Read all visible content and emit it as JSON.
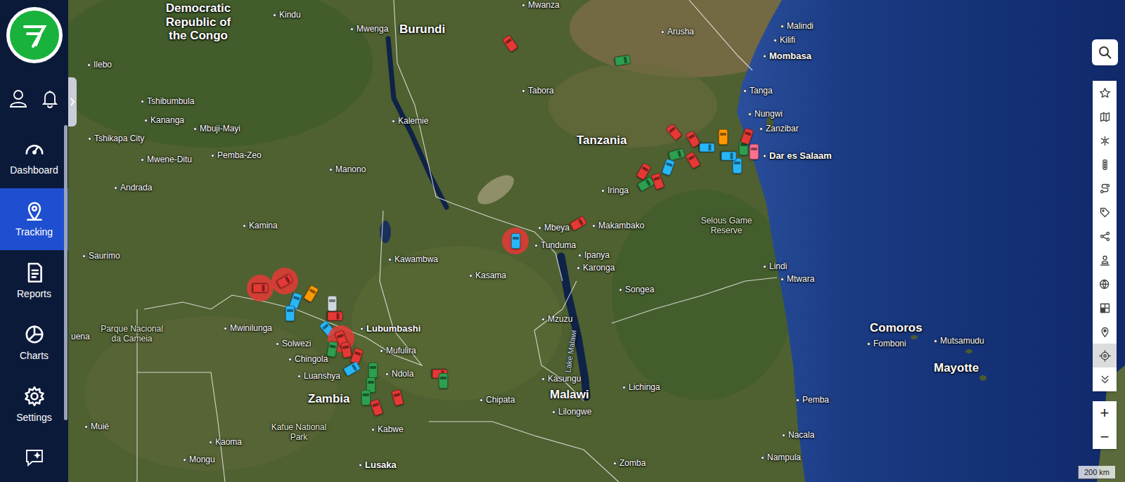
{
  "sidebar": {
    "items": [
      {
        "label": "Dashboard",
        "selected": false
      },
      {
        "label": "Tracking",
        "selected": true
      },
      {
        "label": "Reports",
        "selected": false
      },
      {
        "label": "Charts",
        "selected": false
      },
      {
        "label": "Settings",
        "selected": false
      }
    ]
  },
  "map": {
    "labels": [
      {
        "text": "Democratic Republic of the Congo",
        "kind": "country"
      },
      {
        "text": "Kindu",
        "kind": "city"
      },
      {
        "text": "Mwanza",
        "kind": "city"
      },
      {
        "text": "Burundi",
        "kind": "country"
      },
      {
        "text": "Mwenga",
        "kind": "city"
      },
      {
        "text": "Arusha",
        "kind": "city"
      },
      {
        "text": "Malindi",
        "kind": "city"
      },
      {
        "text": "Kilifi",
        "kind": "city"
      },
      {
        "text": "Mombasa",
        "kind": "major"
      },
      {
        "text": "Ilebo",
        "kind": "city"
      },
      {
        "text": "Tabora",
        "kind": "city"
      },
      {
        "text": "Tanga",
        "kind": "city"
      },
      {
        "text": "Tshibumbula",
        "kind": "city"
      },
      {
        "text": "Nungwi",
        "kind": "city"
      },
      {
        "text": "Kananga",
        "kind": "city"
      },
      {
        "text": "Mbuji-Mayi",
        "kind": "city"
      },
      {
        "text": "Kalemie",
        "kind": "city"
      },
      {
        "text": "Zanzibar",
        "kind": "city"
      },
      {
        "text": "Tshikapa City",
        "kind": "city"
      },
      {
        "text": "Tanzania",
        "kind": "country"
      },
      {
        "text": "Dar es Salaam",
        "kind": "major"
      },
      {
        "text": "Mwene-Ditu",
        "kind": "city"
      },
      {
        "text": "Pemba-Zeo",
        "kind": "city"
      },
      {
        "text": "Manono",
        "kind": "city"
      },
      {
        "text": "Andrada",
        "kind": "city"
      },
      {
        "text": "Iringa",
        "kind": "city"
      },
      {
        "text": "Selous Game Reserve",
        "kind": "area"
      },
      {
        "text": "Kamina",
        "kind": "city"
      },
      {
        "text": "Mbeya",
        "kind": "city"
      },
      {
        "text": "Makambako",
        "kind": "city"
      },
      {
        "text": "Tunduma",
        "kind": "city"
      },
      {
        "text": "Ipanya",
        "kind": "city"
      },
      {
        "text": "Karonga",
        "kind": "city"
      },
      {
        "text": "Saurimo",
        "kind": "city"
      },
      {
        "text": "Kawambwa",
        "kind": "city"
      },
      {
        "text": "Lindi",
        "kind": "city"
      },
      {
        "text": "Mtwara",
        "kind": "city"
      },
      {
        "text": "Kasama",
        "kind": "city"
      },
      {
        "text": "Songea",
        "kind": "city"
      },
      {
        "text": "Mzuzu",
        "kind": "city"
      },
      {
        "text": "Lubumbashi",
        "kind": "major"
      },
      {
        "text": "Mwinilunga",
        "kind": "city"
      },
      {
        "text": "Parque Nacional da Cameia",
        "kind": "area"
      },
      {
        "text": "uena",
        "kind": "town"
      },
      {
        "text": "Comoros",
        "kind": "country"
      },
      {
        "text": "Fomboni",
        "kind": "city"
      },
      {
        "text": "Mutsamudu",
        "kind": "city"
      },
      {
        "text": "Mayotte",
        "kind": "country"
      },
      {
        "text": "Solwezi",
        "kind": "city"
      },
      {
        "text": "Chingola",
        "kind": "city"
      },
      {
        "text": "Mufulira",
        "kind": "city"
      },
      {
        "text": "Luanshya",
        "kind": "city"
      },
      {
        "text": "Ndola",
        "kind": "city"
      },
      {
        "text": "Zambia",
        "kind": "country"
      },
      {
        "text": "Kasungu",
        "kind": "city"
      },
      {
        "text": "Lichinga",
        "kind": "city"
      },
      {
        "text": "Chipata",
        "kind": "city"
      },
      {
        "text": "Malawi",
        "kind": "country"
      },
      {
        "text": "Lilongwe",
        "kind": "city"
      },
      {
        "text": "Pemba",
        "kind": "city"
      },
      {
        "text": "Kafue National Park",
        "kind": "area"
      },
      {
        "text": "Kabwe",
        "kind": "city"
      },
      {
        "text": "Muié",
        "kind": "city"
      },
      {
        "text": "Kaoma",
        "kind": "city"
      },
      {
        "text": "Nacala",
        "kind": "city"
      },
      {
        "text": "Nampula",
        "kind": "city"
      },
      {
        "text": "Mongu",
        "kind": "city"
      },
      {
        "text": "Lusaka",
        "kind": "major"
      },
      {
        "text": "Zomba",
        "kind": "city"
      },
      {
        "text": "Lake Malawi",
        "kind": "water"
      }
    ],
    "vehicles": [
      {
        "color": "#e53935",
        "highlighted": false
      },
      {
        "color": "#2e9e4f",
        "highlighted": false
      },
      {
        "color": "#e53935",
        "highlighted": false
      },
      {
        "color": "#e53935",
        "highlighted": false
      },
      {
        "color": "#2e9e4f",
        "highlighted": false
      },
      {
        "color": "#29b6f6",
        "highlighted": false
      },
      {
        "color": "#e53935",
        "highlighted": false
      },
      {
        "color": "#ff9800",
        "highlighted": false
      },
      {
        "color": "#2e9e4f",
        "highlighted": false
      },
      {
        "color": "#29b6f6",
        "highlighted": false
      },
      {
        "color": "#ff6f91",
        "highlighted": false
      },
      {
        "color": "#29b6f6",
        "highlighted": false
      },
      {
        "color": "#e53935",
        "highlighted": false
      },
      {
        "color": "#e53935",
        "highlighted": false
      },
      {
        "color": "#e53935",
        "highlighted": false
      },
      {
        "color": "#29b6f6",
        "highlighted": false
      },
      {
        "color": "#2e9e4f",
        "highlighted": false
      },
      {
        "color": "#e53935",
        "highlighted": false
      },
      {
        "color": "#29b6f6",
        "highlighted": true
      },
      {
        "color": "#e53935",
        "highlighted": true
      },
      {
        "color": "#e53935",
        "highlighted": true
      },
      {
        "color": "#29b6f6",
        "highlighted": false
      },
      {
        "color": "#ff9800",
        "highlighted": false
      },
      {
        "color": "#29b6f6",
        "highlighted": false
      },
      {
        "color": "#cfd8dc",
        "highlighted": false
      },
      {
        "color": "#e53935",
        "highlighted": false
      },
      {
        "color": "#29b6f6",
        "highlighted": false
      },
      {
        "color": "#e53935",
        "highlighted": true
      },
      {
        "color": "#2e9e4f",
        "highlighted": false
      },
      {
        "color": "#e53935",
        "highlighted": false
      },
      {
        "color": "#e53935",
        "highlighted": false
      },
      {
        "color": "#29b6f6",
        "highlighted": false
      },
      {
        "color": "#2e9e4f",
        "highlighted": false
      },
      {
        "color": "#2e9e4f",
        "highlighted": false
      },
      {
        "color": "#2e9e4f",
        "highlighted": false
      },
      {
        "color": "#e53935",
        "highlighted": false
      },
      {
        "color": "#e53935",
        "highlighted": false
      },
      {
        "color": "#e53935",
        "highlighted": false
      },
      {
        "color": "#2e9e4f",
        "highlighted": false
      }
    ],
    "tools": [
      {
        "selected": false
      },
      {
        "selected": false
      },
      {
        "selected": false
      },
      {
        "selected": false
      },
      {
        "selected": false
      },
      {
        "selected": false
      },
      {
        "selected": false
      },
      {
        "selected": false
      },
      {
        "selected": false
      },
      {
        "selected": false
      },
      {
        "selected": false
      },
      {
        "selected": true
      },
      {
        "selected": false
      }
    ],
    "zoom": {
      "in": "+",
      "out": "−"
    },
    "scale": "200 km"
  }
}
